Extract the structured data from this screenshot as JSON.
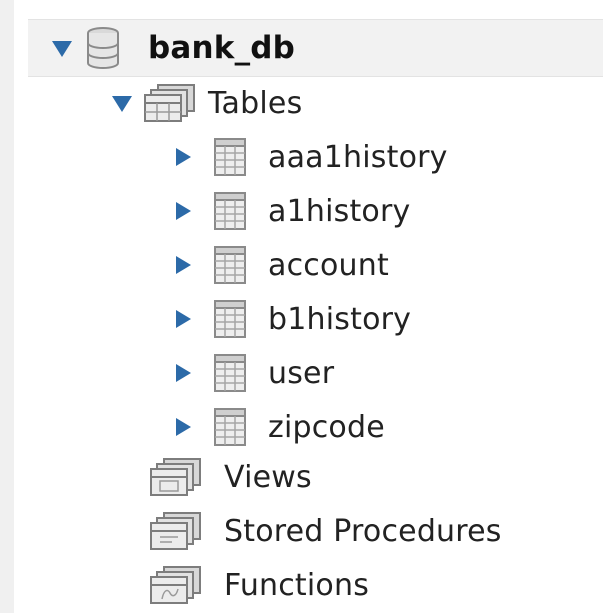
{
  "schema": {
    "name": "bank_db",
    "expanded": true,
    "icon": "database-icon"
  },
  "tables_group": {
    "label": "Tables",
    "expanded": true,
    "icon": "folder-tables-icon",
    "items": [
      {
        "label": "aaa1history",
        "icon": "table-icon"
      },
      {
        "label": "a1history",
        "icon": "table-icon"
      },
      {
        "label": "account",
        "icon": "table-icon"
      },
      {
        "label": "b1history",
        "icon": "table-icon"
      },
      {
        "label": "user",
        "icon": "table-icon"
      },
      {
        "label": "zipcode",
        "icon": "table-icon"
      }
    ]
  },
  "views_group": {
    "label": "Views",
    "icon": "folder-views-icon"
  },
  "procedures_group": {
    "label": "Stored Procedures",
    "icon": "folder-procedures-icon"
  },
  "functions_group": {
    "label": "Functions",
    "icon": "folder-functions-icon"
  },
  "colors": {
    "arrow": "#2c6aa8",
    "selection_bg": "#f2f2f2",
    "text": "#222222"
  }
}
